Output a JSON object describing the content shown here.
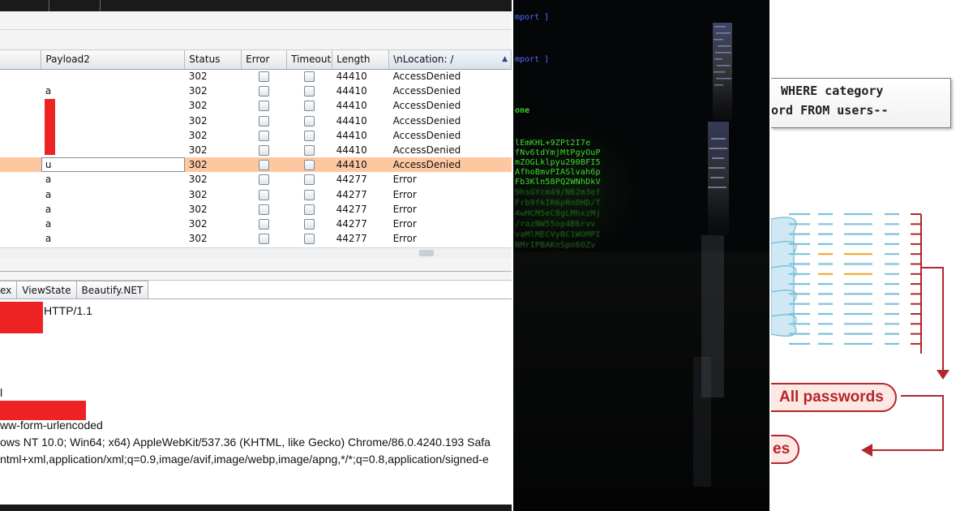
{
  "burp": {
    "columns": [
      "",
      "Payload2",
      "Status",
      "Error",
      "Timeout",
      "Length",
      "\\nLocation: /"
    ],
    "rows": [
      {
        "payload2": "",
        "status": "302",
        "length": "44410",
        "location": "AccessDenied"
      },
      {
        "payload2": "a",
        "status": "302",
        "length": "44410",
        "location": "AccessDenied"
      },
      {
        "payload2": "",
        "status": "302",
        "length": "44410",
        "location": "AccessDenied"
      },
      {
        "payload2": "",
        "status": "302",
        "length": "44410",
        "location": "AccessDenied"
      },
      {
        "payload2": "",
        "status": "302",
        "length": "44410",
        "location": "AccessDenied"
      },
      {
        "payload2": "",
        "status": "302",
        "length": "44410",
        "location": "AccessDenied"
      },
      {
        "payload2": "u",
        "status": "302",
        "length": "44410",
        "location": "AccessDenied",
        "selected": true
      },
      {
        "payload2": "a",
        "status": "302",
        "length": "44277",
        "location": "Error"
      },
      {
        "payload2": "a",
        "status": "302",
        "length": "44277",
        "location": "Error"
      },
      {
        "payload2": "a",
        "status": "302",
        "length": "44277",
        "location": "Error"
      },
      {
        "payload2": "a",
        "status": "302",
        "length": "44277",
        "location": "Error"
      },
      {
        "payload2": "a",
        "status": "302",
        "length": "44277",
        "location": "Error"
      }
    ],
    "tabs": [
      "ex",
      "ViewState",
      "Beautify.NET"
    ],
    "request_lines": {
      "l1": "HTTP/1.1",
      "l2": "l",
      "l3": "ww-form-urlencoded",
      "l4": "ows NT 10.0; Win64; x64) AppleWebKit/537.36 (KHTML, like Gecko) Chrome/86.0.4240.193 Safa",
      "l5": "ntml+xml,application/xml;q=0.9,image/avif,image/webp,image/apng,*/*;q=0.8,application/signed-e"
    },
    "colors": {
      "selected_row": "#fdc8a0",
      "redaction": "#ee2222"
    }
  },
  "terminal": {
    "lines": {
      "import1": "mport ]",
      "import2": "mport ]",
      "one": "one",
      "c1": "lEmKHL+9ZPt2I7e",
      "c2": "fNv6tdYmjMtPgyOuP",
      "c3": "mZOGLklpyu290BFI5",
      "c4": "AfhoBmvPIASlvah6p",
      "c5": "Fb3Kln58PQ2WNhDkV",
      "c6": "9hsGYcm49/N62m3ef",
      "c7": "Frb9fkIR6pRnDHD/T",
      "c8": "4wHCM5eC8gLMhxzMj",
      "c9": "/razNW55op4B6rvv",
      "c10": "vaMlMECVyBC1WOMPI",
      "c11": "NMrIPBAKnSpn6OZv"
    },
    "colors": {
      "import": "#4a6dff",
      "cipher": "#42dc30"
    }
  },
  "diagram": {
    "sql_line1": "WHERE category",
    "sql_line2": "ord FROM users--",
    "all_passwords": "All passwords",
    "bottom_label": "es",
    "colors": {
      "accent": "#b3262a",
      "cylinder": "#cfe8f3",
      "dash_blue": "#7ec1dc",
      "dash_orange": "#f0a830"
    }
  }
}
